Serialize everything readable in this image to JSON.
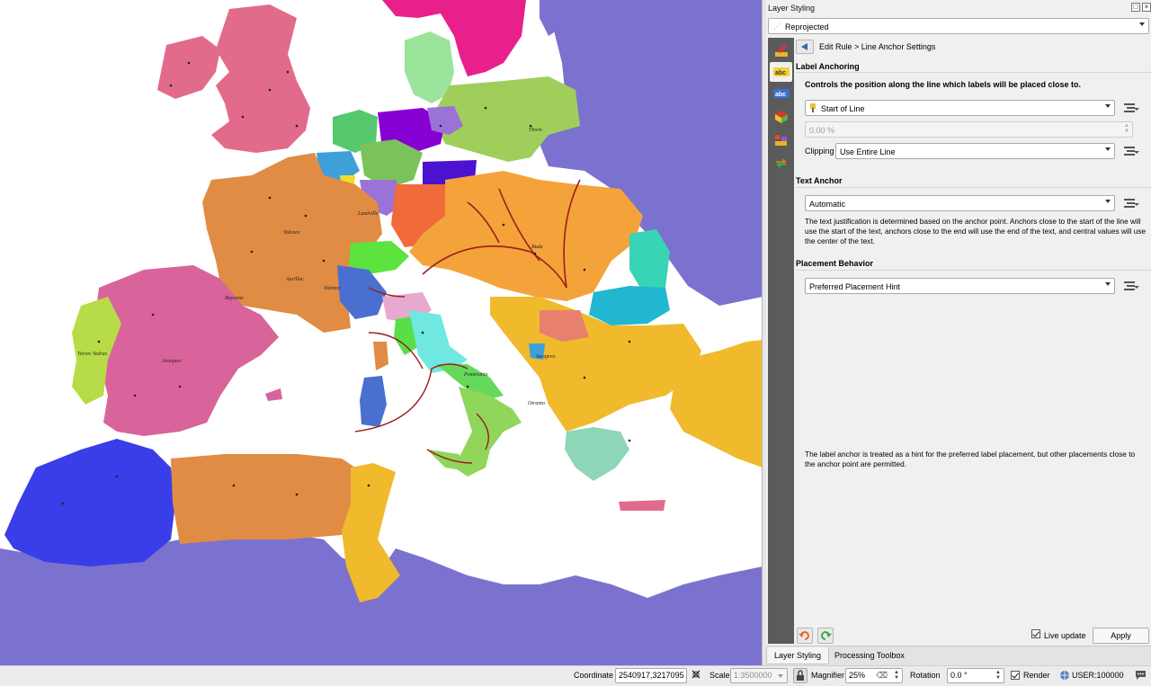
{
  "dock": {
    "title": "Layer Styling",
    "layer": "Reprojected",
    "breadcrumb": "Edit Rule > Line Anchor Settings"
  },
  "label_anchoring": {
    "title": "Label Anchoring",
    "heading": "Controls the position along the line which labels will be placed close to.",
    "anchor_position": "Start of Line",
    "percent_value": "0.00 %",
    "clipping_label": "Clipping",
    "clipping_value": "Use Entire Line"
  },
  "text_anchor": {
    "title": "Text Anchor",
    "value": "Automatic",
    "description": "The text justification is determined based on the anchor point. Anchors close to the start of the line will use the start of the text, anchors close to the end will use the end of the text, and central values will use the center of the text."
  },
  "placement": {
    "title": "Placement Behavior",
    "value": "Preferred Placement Hint",
    "description": "The label anchor is treated as a hint for the preferred label placement, but other placements close to the anchor point are permitted."
  },
  "footer": {
    "live_update_label": "Live update",
    "apply_label": "Apply"
  },
  "dock_tabs": [
    "Layer Styling",
    "Processing Toolbox"
  ],
  "statusbar": {
    "coordinate_label": "Coordinate",
    "coordinate_value": "2540917,3217095",
    "scale_label": "Scale",
    "scale_value": "1:3500000",
    "magnifier_label": "Magnifier",
    "magnifier_value": "25%",
    "rotation_label": "Rotation",
    "rotation_value": "0.0 °",
    "render_label": "Render",
    "crs_label": "USER:100000"
  },
  "map": {
    "labels": [
      "Lunéville",
      "Valence",
      "Aurillac",
      "Valence",
      "Bayonne",
      "Torres Vedras",
      "Aranjuez",
      "Buda",
      "Pomerania",
      "Thorn",
      "Otranto",
      "Sarajevo"
    ]
  }
}
